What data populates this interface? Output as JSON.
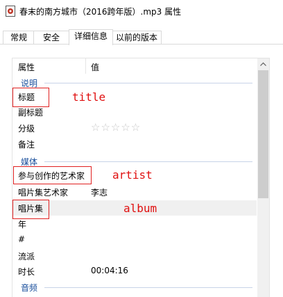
{
  "window": {
    "title": "春末的南方城市（2016跨年版）.mp3 属性"
  },
  "tabs": [
    {
      "label": "常规"
    },
    {
      "label": "安全"
    },
    {
      "label": "详细信息"
    },
    {
      "label": "以前的版本"
    }
  ],
  "header": {
    "property": "属性",
    "value": "值"
  },
  "groups": {
    "description": "说明",
    "media": "媒体",
    "audio": "音频"
  },
  "rows": {
    "title": {
      "label": "标题",
      "value": ""
    },
    "subtitle": {
      "label": "副标题",
      "value": ""
    },
    "rating": {
      "label": "分级",
      "stars": "☆☆☆☆☆",
      "value_fraction": 0
    },
    "comment": {
      "label": "备注",
      "value": ""
    },
    "artist": {
      "label": "参与创作的艺术家",
      "value": ""
    },
    "album_artist": {
      "label": "唱片集艺术家",
      "value": "李志"
    },
    "album": {
      "label": "唱片集",
      "value": ""
    },
    "year": {
      "label": "年",
      "value": ""
    },
    "track": {
      "label": "#",
      "value": ""
    },
    "genre": {
      "label": "流派",
      "value": ""
    },
    "length": {
      "label": "时长",
      "value": "00:04:16"
    }
  },
  "annotations": {
    "title": "title",
    "artist": "artist",
    "album": "album"
  },
  "colors": {
    "annotation": "#e01010",
    "group_label": "#1a4f9c",
    "hover_row": "#f0f0f0"
  }
}
